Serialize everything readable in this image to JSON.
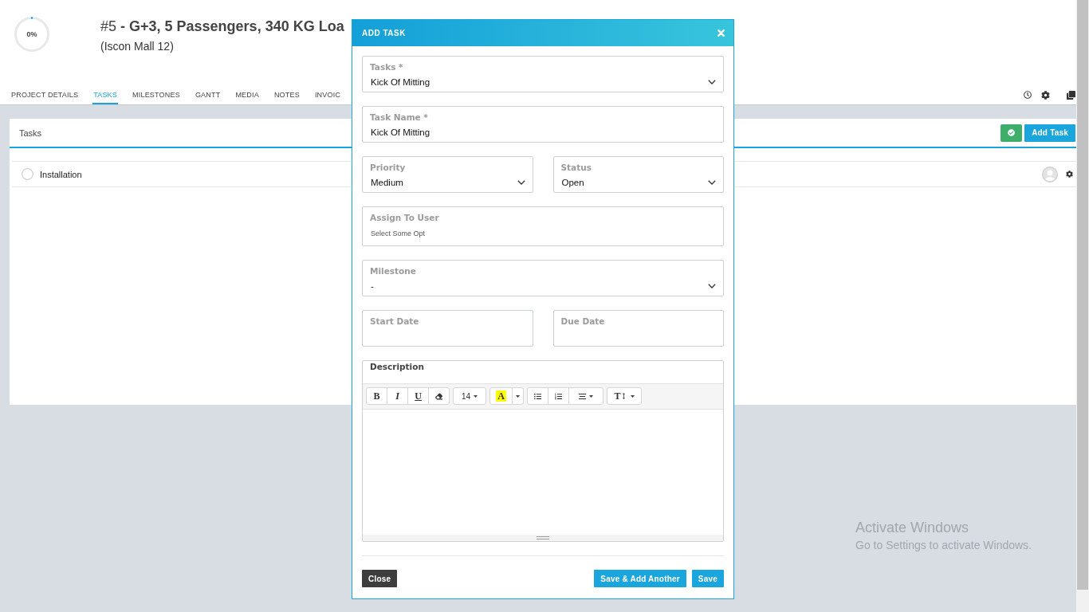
{
  "project": {
    "progress": {
      "label": "0%",
      "level": 0
    },
    "title": "#5 **- G+3, 5 Passengers, 340 KG Loa**",
    "subtitle": "(Iscon Mall 12)"
  },
  "tabs": [
    {
      "label": "PROJECT DETAILS",
      "selected": false
    },
    {
      "label": "TASKS",
      "selected": true
    },
    {
      "label": "MILESTONES",
      "selected": false
    },
    {
      "label": "GANTT",
      "selected": false
    },
    {
      "label": "MEDIA",
      "selected": false
    },
    {
      "label": "NOTES",
      "selected": false
    },
    {
      "label": "INVOIC",
      "selected": false
    }
  ],
  "tasks_panel": {
    "title": "Tasks",
    "add_button": "Add Task",
    "rows": [
      {
        "name": "Installation",
        "completed": false
      }
    ]
  },
  "modal": {
    "title": "ADD TASK",
    "rows": [
      {
        "fields": [
          {
            "kind": "select",
            "label": "Tasks *",
            "value": "Kick Of Mitting"
          }
        ]
      },
      {
        "fields": [
          {
            "kind": "input",
            "label": "Task Name *",
            "value": "Kick Of Mitting"
          }
        ]
      },
      {
        "fields": [
          {
            "kind": "select",
            "label": "Priority",
            "value": "Medium"
          },
          {
            "kind": "select",
            "label": "Status",
            "value": "Open"
          }
        ]
      },
      {
        "fields": [
          {
            "kind": "multiselect",
            "label": "Assign To User",
            "placeholder": "Select Some Opt"
          }
        ]
      },
      {
        "fields": [
          {
            "kind": "select",
            "label": "Milestone",
            "value": "-"
          }
        ]
      },
      {
        "fields": [
          {
            "kind": "date",
            "label": "Start Date"
          },
          {
            "kind": "date",
            "label": "Due Date"
          }
        ]
      }
    ],
    "description": {
      "label": "Description",
      "toolbar": [
        {
          "items": [
            {
              "kind": "bold",
              "label": "B"
            },
            {
              "kind": "italic",
              "label": "I"
            },
            {
              "kind": "underline",
              "label": "U"
            },
            {
              "kind": "eraser"
            }
          ]
        },
        {
          "items": [
            {
              "kind": "font_size",
              "label": "14"
            }
          ]
        },
        {
          "items": [
            {
              "kind": "highlight",
              "label": "A"
            },
            {
              "kind": "caret"
            }
          ]
        },
        {
          "items": [
            {
              "kind": "bullets"
            },
            {
              "kind": "numbers"
            },
            {
              "kind": "align"
            }
          ]
        },
        {
          "items": [
            {
              "kind": "line_height",
              "label": "T"
            }
          ]
        }
      ]
    },
    "buttons": [
      {
        "kind": "secondary",
        "label": "Close"
      },
      {
        "kind": "primary",
        "label": "Save & Add Another"
      },
      {
        "kind": "primary",
        "label": "Save"
      }
    ]
  },
  "os_notice": {
    "title": "Activate Windows",
    "subtitle": "Go to Settings to activate Windows."
  }
}
